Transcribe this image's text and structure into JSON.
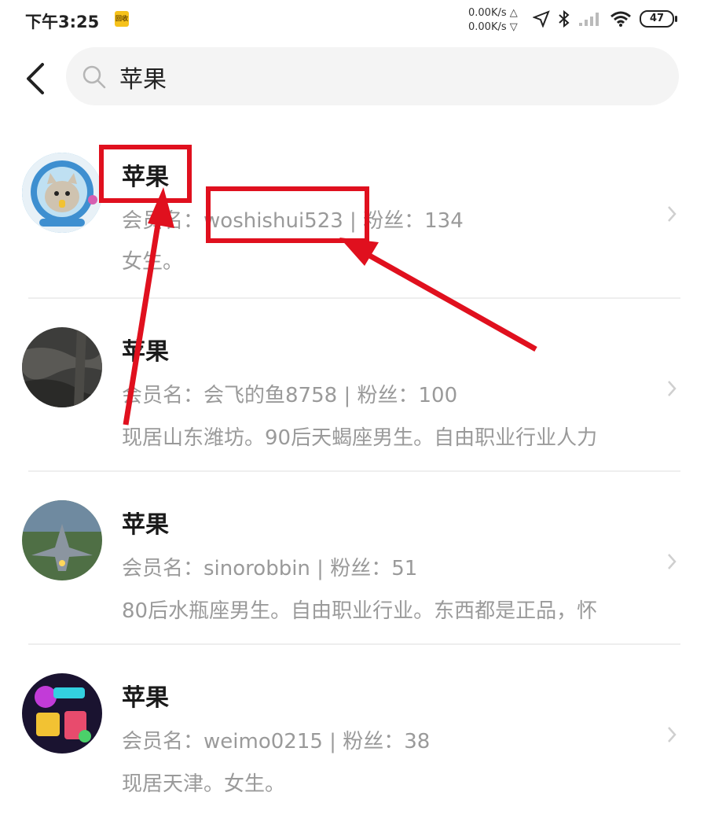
{
  "status_bar": {
    "time": "下午3:25",
    "app_badge": "回收",
    "net_up": "0.00K/s △",
    "net_down": "0.00K/s ▽",
    "battery": "47"
  },
  "search": {
    "query": "苹果"
  },
  "results": [
    {
      "name": "苹果",
      "member_label": "会员名：",
      "member": "woshishui523",
      "sep": " | ",
      "fans_label": "粉丝：",
      "fans": "134",
      "bio": "女生。"
    },
    {
      "name": "苹果",
      "member_label": "会员名：",
      "member": "会飞的鱼8758",
      "sep": " | ",
      "fans_label": "粉丝：",
      "fans": "100",
      "bio": "现居山东潍坊。90后天蝎座男生。自由职业行业人力"
    },
    {
      "name": "苹果",
      "member_label": "会员名：",
      "member": "sinorobbin",
      "sep": " | ",
      "fans_label": "粉丝：",
      "fans": "51",
      "bio": "80后水瓶座男生。自由职业行业。东西都是正品，怀"
    },
    {
      "name": "苹果",
      "member_label": "会员名：",
      "member": "weimo0215",
      "sep": " | ",
      "fans_label": "粉丝：",
      "fans": "38",
      "bio": "现居天津。女生。"
    }
  ],
  "colors": {
    "annotation": "#e0101e",
    "muted_text": "#9a9a9a"
  },
  "icons": [
    "back-arrow-icon",
    "search-icon",
    "chevron-right-icon",
    "location-icon",
    "bluetooth-icon",
    "signal-icon",
    "wifi-icon",
    "battery-icon"
  ]
}
